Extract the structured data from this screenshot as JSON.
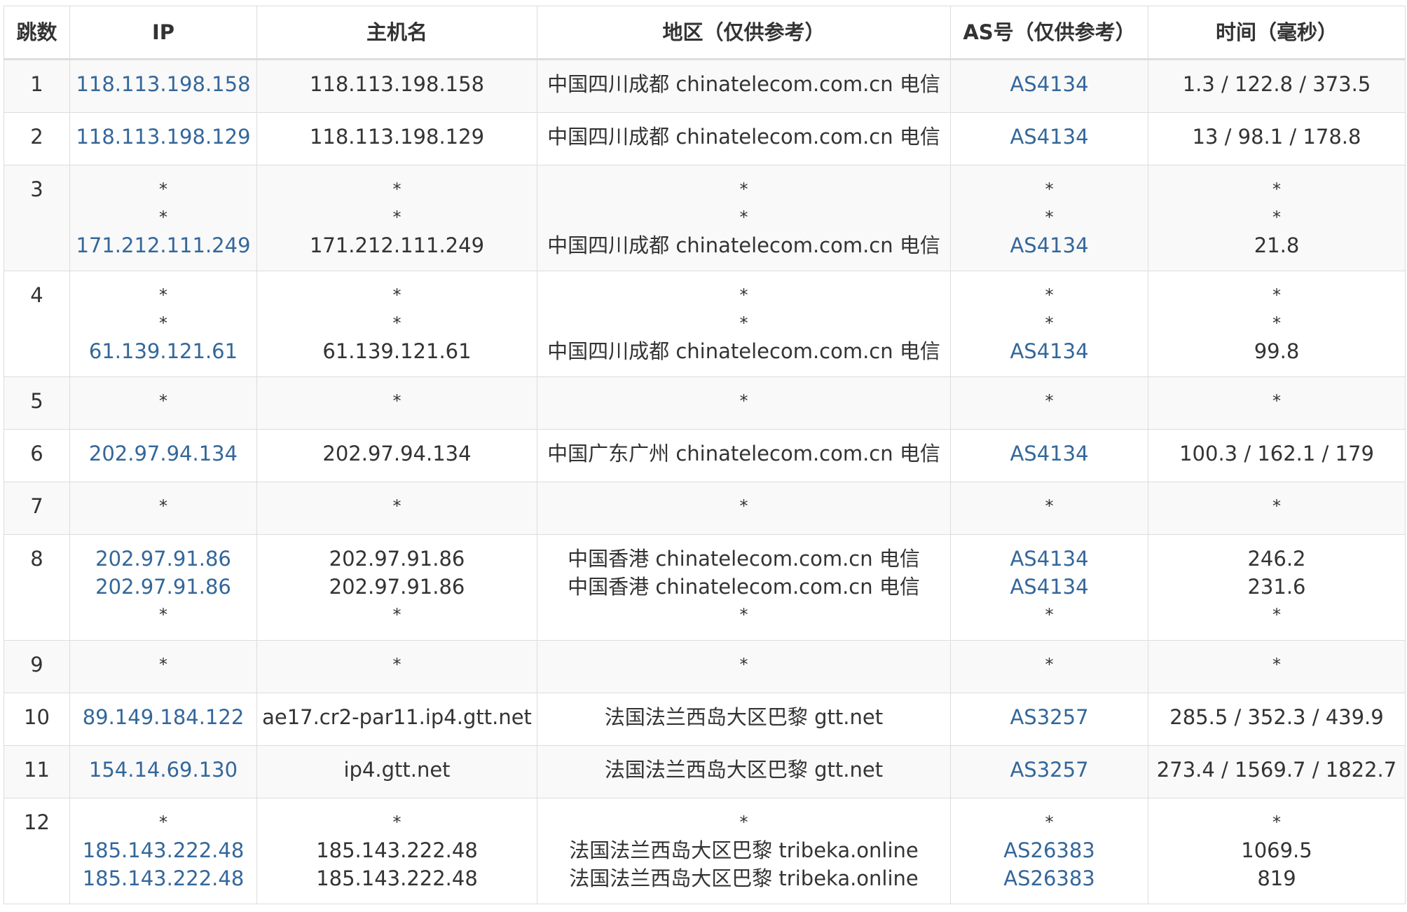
{
  "headers": {
    "hop": "跳数",
    "ip": "IP",
    "hostname": "主机名",
    "region": "地区（仅供参考）",
    "asn": "AS号（仅供参考）",
    "time": "时间（毫秒）"
  },
  "rows": [
    {
      "hop": "1",
      "ip": [
        "118.113.198.158"
      ],
      "host": [
        "118.113.198.158"
      ],
      "region": [
        "中国四川成都 chinatelecom.com.cn 电信"
      ],
      "asn": [
        "AS4134"
      ],
      "time": [
        "1.3 / 122.8 / 373.5"
      ]
    },
    {
      "hop": "2",
      "ip": [
        "118.113.198.129"
      ],
      "host": [
        "118.113.198.129"
      ],
      "region": [
        "中国四川成都 chinatelecom.com.cn 电信"
      ],
      "asn": [
        "AS4134"
      ],
      "time": [
        "13 / 98.1 / 178.8"
      ]
    },
    {
      "hop": "3",
      "ip": [
        "*",
        "*",
        "171.212.111.249"
      ],
      "host": [
        "*",
        "*",
        "171.212.111.249"
      ],
      "region": [
        "*",
        "*",
        "中国四川成都 chinatelecom.com.cn 电信"
      ],
      "asn": [
        "*",
        "*",
        "AS4134"
      ],
      "time": [
        "*",
        "*",
        "21.8"
      ]
    },
    {
      "hop": "4",
      "ip": [
        "*",
        "*",
        "61.139.121.61"
      ],
      "host": [
        "*",
        "*",
        "61.139.121.61"
      ],
      "region": [
        "*",
        "*",
        "中国四川成都 chinatelecom.com.cn 电信"
      ],
      "asn": [
        "*",
        "*",
        "AS4134"
      ],
      "time": [
        "*",
        "*",
        "99.8"
      ]
    },
    {
      "hop": "5",
      "ip": [
        "*"
      ],
      "host": [
        "*"
      ],
      "region": [
        "*"
      ],
      "asn": [
        "*"
      ],
      "time": [
        "*"
      ]
    },
    {
      "hop": "6",
      "ip": [
        "202.97.94.134"
      ],
      "host": [
        "202.97.94.134"
      ],
      "region": [
        "中国广东广州 chinatelecom.com.cn 电信"
      ],
      "asn": [
        "AS4134"
      ],
      "time": [
        "100.3 / 162.1 / 179"
      ]
    },
    {
      "hop": "7",
      "ip": [
        "*"
      ],
      "host": [
        "*"
      ],
      "region": [
        "*"
      ],
      "asn": [
        "*"
      ],
      "time": [
        "*"
      ]
    },
    {
      "hop": "8",
      "ip": [
        "202.97.91.86",
        "202.97.91.86",
        "*"
      ],
      "host": [
        "202.97.91.86",
        "202.97.91.86",
        "*"
      ],
      "region": [
        "中国香港 chinatelecom.com.cn 电信",
        "中国香港 chinatelecom.com.cn 电信",
        "*"
      ],
      "asn": [
        "AS4134",
        "AS4134",
        "*"
      ],
      "time": [
        "246.2",
        "231.6",
        "*"
      ]
    },
    {
      "hop": "9",
      "ip": [
        "*"
      ],
      "host": [
        "*"
      ],
      "region": [
        "*"
      ],
      "asn": [
        "*"
      ],
      "time": [
        "*"
      ]
    },
    {
      "hop": "10",
      "ip": [
        "89.149.184.122"
      ],
      "host": [
        "ae17.cr2-par11.ip4.gtt.net"
      ],
      "region": [
        "法国法兰西岛大区巴黎 gtt.net"
      ],
      "asn": [
        "AS3257"
      ],
      "time": [
        "285.5 / 352.3 / 439.9"
      ]
    },
    {
      "hop": "11",
      "ip": [
        "154.14.69.130"
      ],
      "host": [
        "ip4.gtt.net"
      ],
      "region": [
        "法国法兰西岛大区巴黎 gtt.net"
      ],
      "asn": [
        "AS3257"
      ],
      "time": [
        "273.4 / 1569.7 / 1822.7"
      ]
    },
    {
      "hop": "12",
      "ip": [
        "*",
        "185.143.222.48",
        "185.143.222.48"
      ],
      "host": [
        "*",
        "185.143.222.48",
        "185.143.222.48"
      ],
      "region": [
        "*",
        "法国法兰西岛大区巴黎 tribeka.online",
        "法国法兰西岛大区巴黎 tribeka.online"
      ],
      "asn": [
        "*",
        "AS26383",
        "AS26383"
      ],
      "time": [
        "*",
        "1069.5",
        "819"
      ]
    }
  ],
  "colors": {
    "link": "#34679a",
    "text": "#333333",
    "border": "#dddddd",
    "row_alt": "#f9f9f9"
  }
}
